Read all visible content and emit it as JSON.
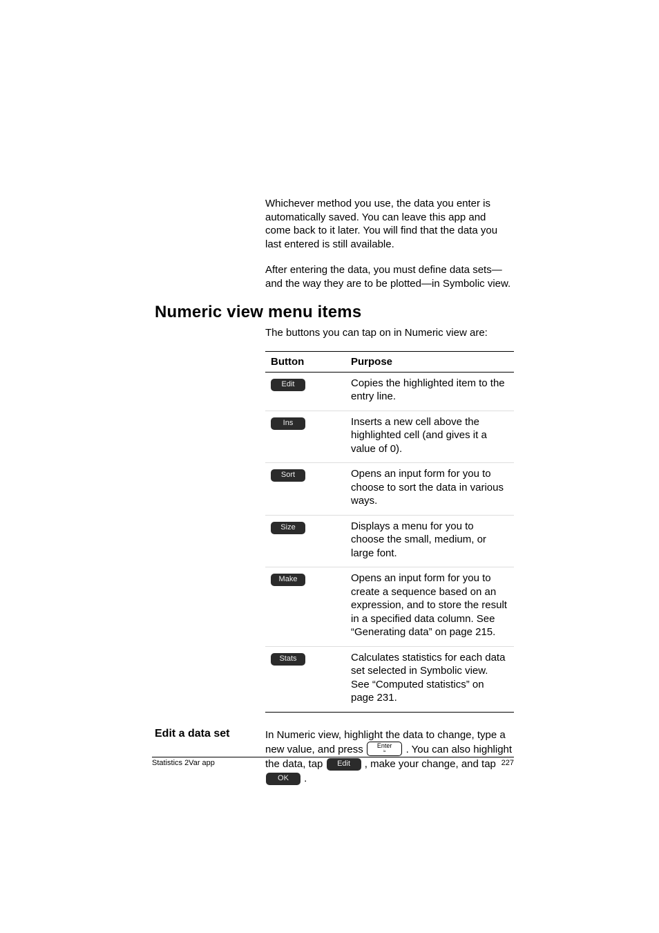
{
  "paragraphs": {
    "p1": "Whichever method you use, the data you enter is automatically saved. You can leave this app and come back to it later. You will find that the data you last entered is still available.",
    "p2": "After entering the data, you must define data sets—and the way they are to be plotted—in Symbolic view."
  },
  "section_title": "Numeric view menu items",
  "intro": "The buttons you can tap on in Numeric view are:",
  "table": {
    "head_button": "Button",
    "head_purpose": "Purpose",
    "rows": [
      {
        "button": "Edit",
        "purpose": "Copies the highlighted item to the entry line."
      },
      {
        "button": "Ins",
        "purpose": "Inserts a new cell above the highlighted cell (and gives it a value of 0)."
      },
      {
        "button": "Sort",
        "purpose": "Opens an input form for you to choose to sort the data in various ways."
      },
      {
        "button": "Size",
        "purpose": "Displays a menu for you to choose the small, medium, or large font."
      },
      {
        "button": "Make",
        "purpose": "Opens an input form for you to create a sequence based on an expression, and to store the result in a specified data column. See “Generating data” on page 215."
      },
      {
        "button": "Stats",
        "purpose": "Calculates statistics for each data set selected in Symbolic view. See “Computed statistics” on page 231."
      }
    ]
  },
  "edit": {
    "heading": "Edit a data set",
    "pre": "In Numeric view, highlight the data to change, type a new value, and press ",
    "enter_key_top": "Enter",
    "enter_key_bottom": "≈",
    "mid1": ". You can also highlight the data, tap ",
    "btn_edit": "Edit",
    "mid2": ", make your change, and tap ",
    "btn_ok": "OK",
    "post": "."
  },
  "footer": {
    "left": "Statistics 2Var app",
    "right": "227"
  }
}
